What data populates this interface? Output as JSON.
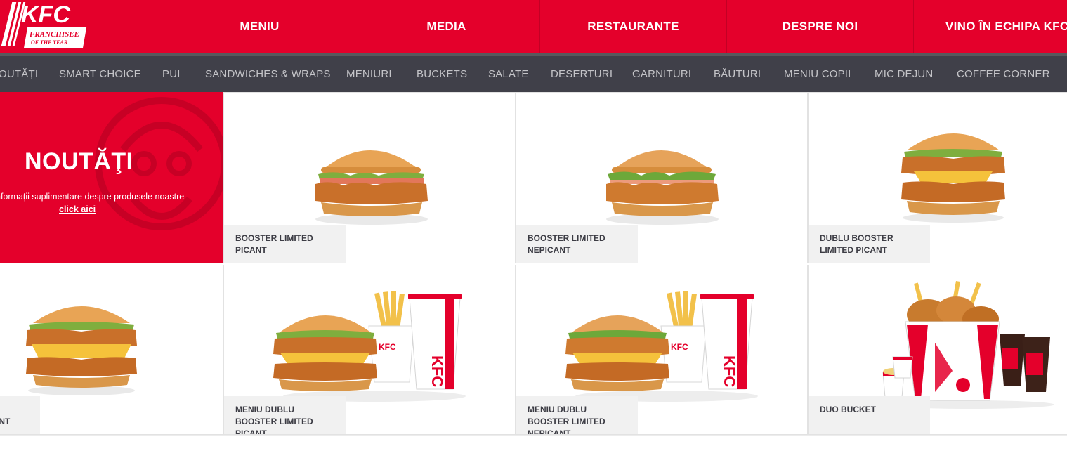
{
  "brand": {
    "logo_text": "KFC",
    "logo_tagline_1": "FRANCHISEE",
    "logo_tagline_2": "OF THE YEAR",
    "red": "#e4002b",
    "dark": "#404049"
  },
  "main_nav": [
    {
      "label": "MENIU"
    },
    {
      "label": "MEDIA"
    },
    {
      "label": "RESTAURANTE"
    },
    {
      "label": "DESPRE NOI"
    },
    {
      "label": "VINO ÎN ECHIPA KFC"
    }
  ],
  "sub_nav": [
    {
      "label": "NOUTĂȚI"
    },
    {
      "label": "SMART CHOICE"
    },
    {
      "label": "PUI"
    },
    {
      "label": "SANDWICHES & WRAPS"
    },
    {
      "label": "MENIURI"
    },
    {
      "label": "BUCKETS"
    },
    {
      "label": "SALATE"
    },
    {
      "label": "DESERTURI"
    },
    {
      "label": "GARNITURI"
    },
    {
      "label": "BĂUTURI"
    },
    {
      "label": "MENIU COPII"
    },
    {
      "label": "MIC DEJUN"
    },
    {
      "label": "COFFEE CORNER"
    }
  ],
  "hero": {
    "title": "NOUTĂŢI",
    "info_text": "nformații suplimentare despre produsele noastre",
    "link_text": "click aici",
    "link_suffix": "."
  },
  "products": [
    {
      "name": "BOOSTER LIMITED PICANT",
      "icon": "burger-icon"
    },
    {
      "name": "BOOSTER LIMITED NEPICANT",
      "icon": "burger-icon"
    },
    {
      "name": "DUBLU BOOSTER LIMITED PICANT",
      "icon": "double-burger-icon"
    },
    {
      "name": "ER\nCANT",
      "icon": "double-burger-icon"
    },
    {
      "name": "MENIU DUBLU BOOSTER LIMITED PICANT",
      "icon": "menu-combo-icon"
    },
    {
      "name": "MENIU DUBLU BOOSTER LIMITED NEPICANT",
      "icon": "menu-combo-icon"
    },
    {
      "name": "DUO BUCKET",
      "icon": "bucket-icon"
    }
  ]
}
